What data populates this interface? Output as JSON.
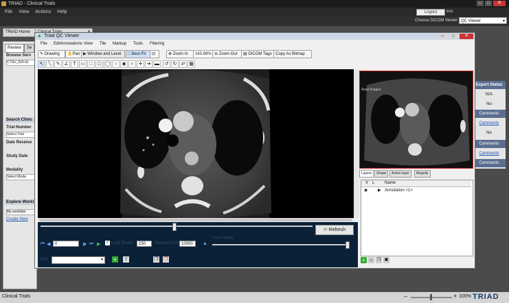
{
  "app": {
    "title": "TRIAD - Clinical Trials",
    "menus": [
      "File",
      "View",
      "Actions",
      "Help"
    ],
    "logout_label": "Logout",
    "logout_aux": "ess",
    "viewer_label": "Choose DICOM Viewer",
    "viewer_value": "QC Viewer"
  },
  "tabs": [
    "TRIAD Home",
    "Clinical Trials"
  ],
  "left_panel": {
    "review_tab": "Review",
    "second_tab": "Se",
    "browse_label": "Browse Serv",
    "browse_value": "CTSU_525-Gi",
    "search_header": "Search Clinic",
    "trial_number_label": "Trial Number",
    "trial_number_value": "Select Trial",
    "date_received_label": "Date Receive",
    "study_date_label": "Study Date",
    "modality_label": "Modality",
    "modality_value": "Select Moda",
    "explore_header": "Explore Workl",
    "my_worklist": "My worklists",
    "create_new": "Create New"
  },
  "right_panel": {
    "export_status": "Export Status",
    "na": "N/A",
    "no1": "No",
    "comments1": "Comments",
    "no2": "No",
    "comments2": "Comments",
    "comments3": "Comments"
  },
  "dialog": {
    "title": "Triad QC Viewer",
    "menus": [
      "File",
      "EditAnnotations",
      "View",
      "Tile",
      "Markup",
      "Tools",
      "Filtering"
    ],
    "toolbar": {
      "drawing": "Drawing",
      "pan": "Pan",
      "window_level": "Window and Level",
      "best_fit": "Best Fit",
      "zoom_in": "Zoom In",
      "zoom_value": "163.89%",
      "zoom_out": "Zoom Out",
      "dicom_tags": "DICOM Tags",
      "copy_bitmap": "Copy As Bitmap"
    },
    "controls": {
      "refresh": "Refresh",
      "frame_value": "0",
      "window_width_label": "Lock Sound",
      "window_width_value": "150",
      "level_label": "Window Center",
      "level_value": "10000",
      "opacity_label": "Layer Opacity",
      "select_label": "ROI"
    },
    "preview_label": "Axial Images",
    "layers_tabs": [
      "Layers",
      "Shape",
      "Active layer",
      "Magnify"
    ],
    "layers_header": [
      "V",
      "L",
      "Name"
    ],
    "layer_row_name": "Annotation <1>"
  },
  "statusbar": {
    "left_text": "Clinical Trials",
    "zoom": "100%",
    "brand": "TRIAD"
  },
  "colors": {
    "titlebar": "#1c1c1c",
    "controls_bg": "#0b2138",
    "preview_border": "#cc2222",
    "brand": "#1a3a6a"
  }
}
